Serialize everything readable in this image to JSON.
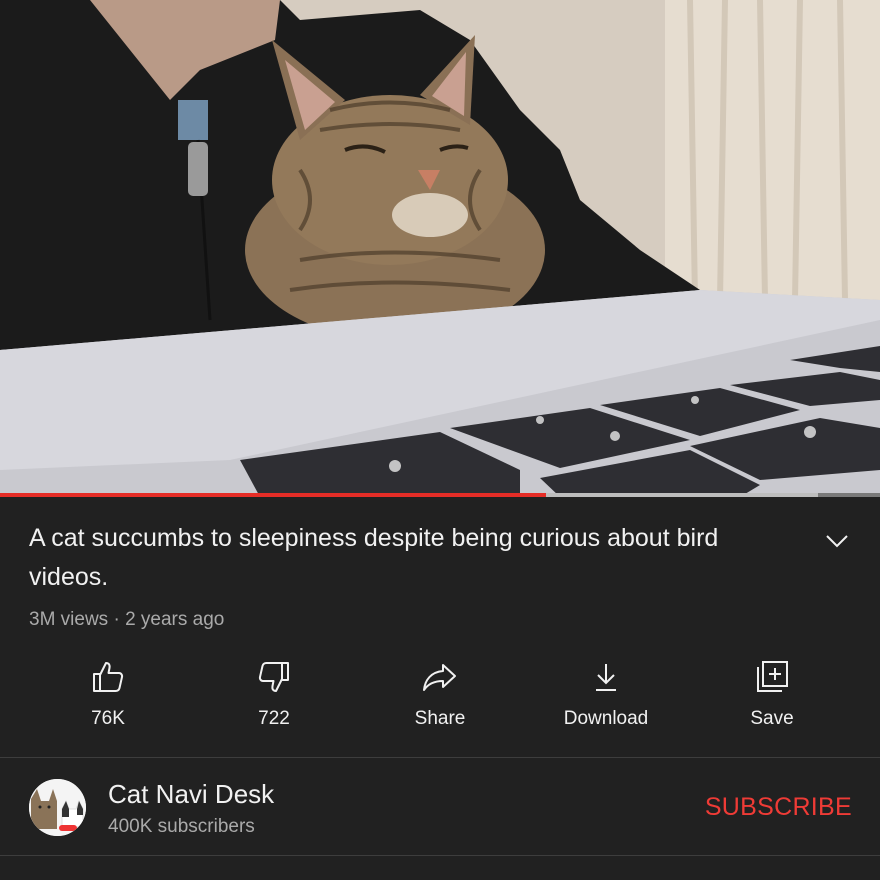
{
  "video": {
    "title": "A cat succumbs to sleepiness despite being curious about bird videos.",
    "views": "3M views",
    "age": "2 years ago",
    "progress_played": 0.62,
    "progress_buffered": 0.93
  },
  "actions": [
    {
      "label": "76K",
      "icon": "thumbs-up-icon"
    },
    {
      "label": "722",
      "icon": "thumbs-down-icon"
    },
    {
      "label": "Share",
      "icon": "share-icon"
    },
    {
      "label": "Download",
      "icon": "download-icon"
    },
    {
      "label": "Save",
      "icon": "add-to-playlist-icon"
    }
  ],
  "channel": {
    "name": "Cat Navi Desk",
    "subscribers": "400K subscribers",
    "subscribe_label": "SUBSCRIBE"
  },
  "colors": {
    "background": "#212121",
    "accent": "#e52d27",
    "subscribe": "#ef3b36",
    "secondary_text": "#aaaaaa"
  }
}
